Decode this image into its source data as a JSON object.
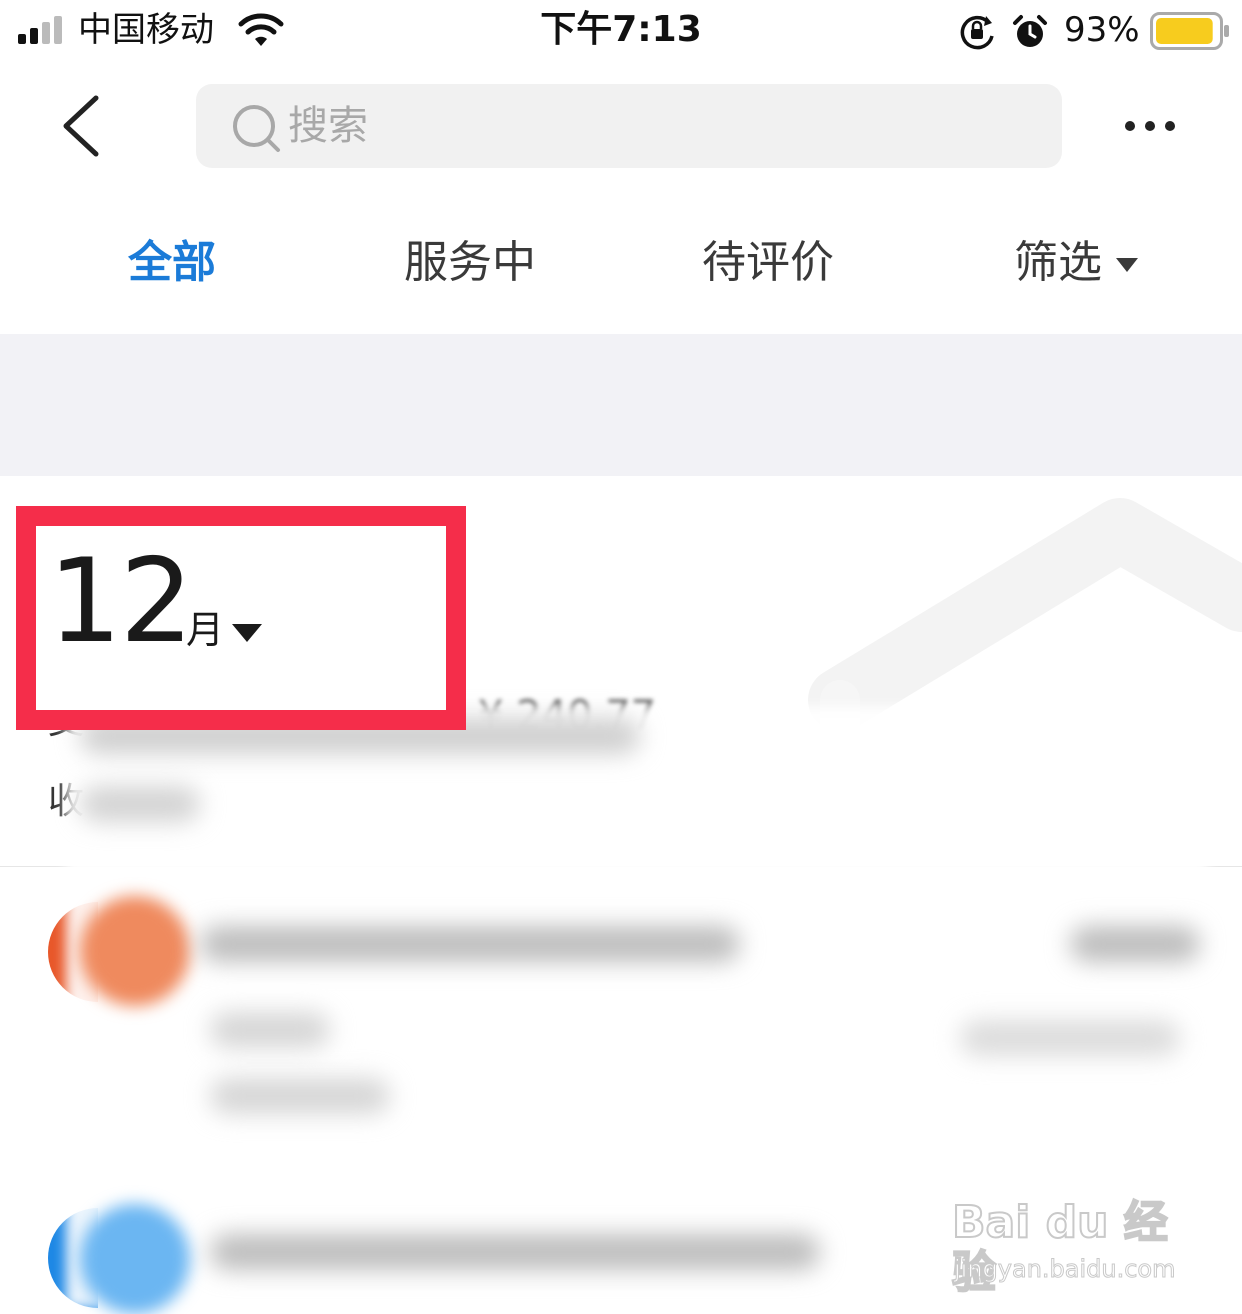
{
  "status_bar": {
    "carrier": "中国移动",
    "time": "下午7:13",
    "battery_percent": "93%",
    "battery_level": 0.93,
    "battery_color": "#f7cc1e"
  },
  "nav": {
    "back_icon": "chevron-left-icon",
    "search_placeholder": "搜索",
    "more_icon": "more-horizontal-icon"
  },
  "tabs": [
    {
      "label": "全部",
      "active": true
    },
    {
      "label": "服务中",
      "active": false
    },
    {
      "label": "待评价",
      "active": false
    },
    {
      "label": "筛选",
      "active": false
    }
  ],
  "month_picker": {
    "month": "12",
    "unit": "月"
  },
  "summary": {
    "line1_prefix": "支",
    "amount": "¥ 240.77",
    "line2_prefix": "收"
  },
  "watermark": {
    "brand": "Bai du 经验",
    "url": "jingyan.baidu.com"
  },
  "colors": {
    "accent": "#1b7bd8",
    "highlight": "#f52d4a",
    "band": "#f2f2f6"
  }
}
